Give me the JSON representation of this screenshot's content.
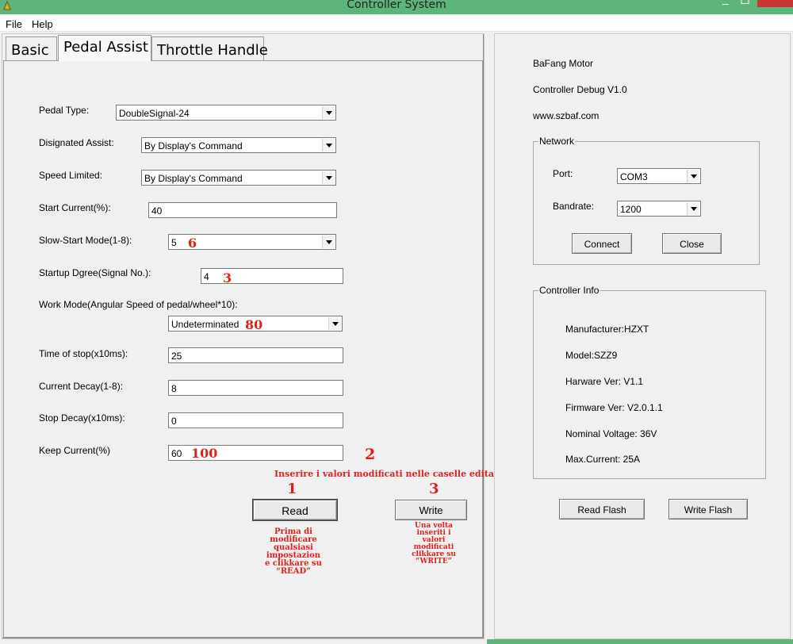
{
  "window": {
    "title": "Controller System",
    "accent_color": "#5eb57b",
    "close_color": "#c7372f"
  },
  "menu": {
    "file": "File",
    "help": "Help"
  },
  "tabs": [
    {
      "label": "Basic",
      "active": false
    },
    {
      "label": "Pedal Assist",
      "active": true
    },
    {
      "label": "Throttle Handle",
      "active": false
    }
  ],
  "pedal": {
    "pedal_type": {
      "label": "Pedal Type:",
      "value": "DoubleSignal-24"
    },
    "designated_assist": {
      "label": "Disignated Assist:",
      "value": "By Display's Command"
    },
    "speed_limited": {
      "label": "Speed Limited:",
      "value": "By Display's Command"
    },
    "start_current": {
      "label": "Start Current(%):",
      "value": "40"
    },
    "slow_start_mode": {
      "label": "Slow-Start Mode(1-8):",
      "value": "5"
    },
    "startup_degree": {
      "label": "Startup Dgree(Signal No.):",
      "value": "4"
    },
    "work_mode": {
      "label": "Work Mode(Angular Speed of pedal/wheel*10):",
      "value": "Undeterminated"
    },
    "time_of_stop": {
      "label": "Time of stop(x10ms):",
      "value": "25"
    },
    "current_decay": {
      "label": "Current Decay(1-8):",
      "value": "8"
    },
    "stop_decay": {
      "label": "Stop Decay(x10ms):",
      "value": "0"
    },
    "keep_current": {
      "label": "Keep Current(%)",
      "value": "60"
    },
    "read_button": "Read",
    "write_button": "Write"
  },
  "annotations": {
    "slow_start_new": "6",
    "startup_degree_new": "3",
    "work_mode_new": "80",
    "keep_current_new": "100",
    "step_2": "2",
    "step_1": "1",
    "step_3": "3",
    "instruction_main": "Inserire i valori modificati nelle caselle editabili",
    "read_note_lines": [
      "Prima di",
      "modificare",
      "qualsiasi",
      "impostazion",
      "e clikkare su",
      "“READ”"
    ],
    "write_note_lines": [
      "Una volta",
      "inseriti i",
      "valori",
      "modificati",
      "clikkare su",
      "“WRITE”"
    ]
  },
  "info": {
    "brand": "BaFang Motor",
    "debug": "Controller Debug V1.0",
    "site": "www.szbaf.com"
  },
  "network": {
    "legend": "Network",
    "port_label": "Port:",
    "port_value": "COM3",
    "baud_label": "Bandrate:",
    "baud_value": "1200",
    "connect": "Connect",
    "close": "Close"
  },
  "controller_info": {
    "legend": "Controller Info",
    "manufacturer": "Manufacturer:HZXT",
    "model": "Model:SZZ9",
    "hardware": "Harware Ver: V1.1",
    "firmware": "Firmware Ver: V2.0.1.1",
    "voltage": "Nominal Voltage: 36V",
    "max_current": "Max.Current: 25A"
  },
  "flash": {
    "read": "Read Flash",
    "write": "Write Flash"
  }
}
